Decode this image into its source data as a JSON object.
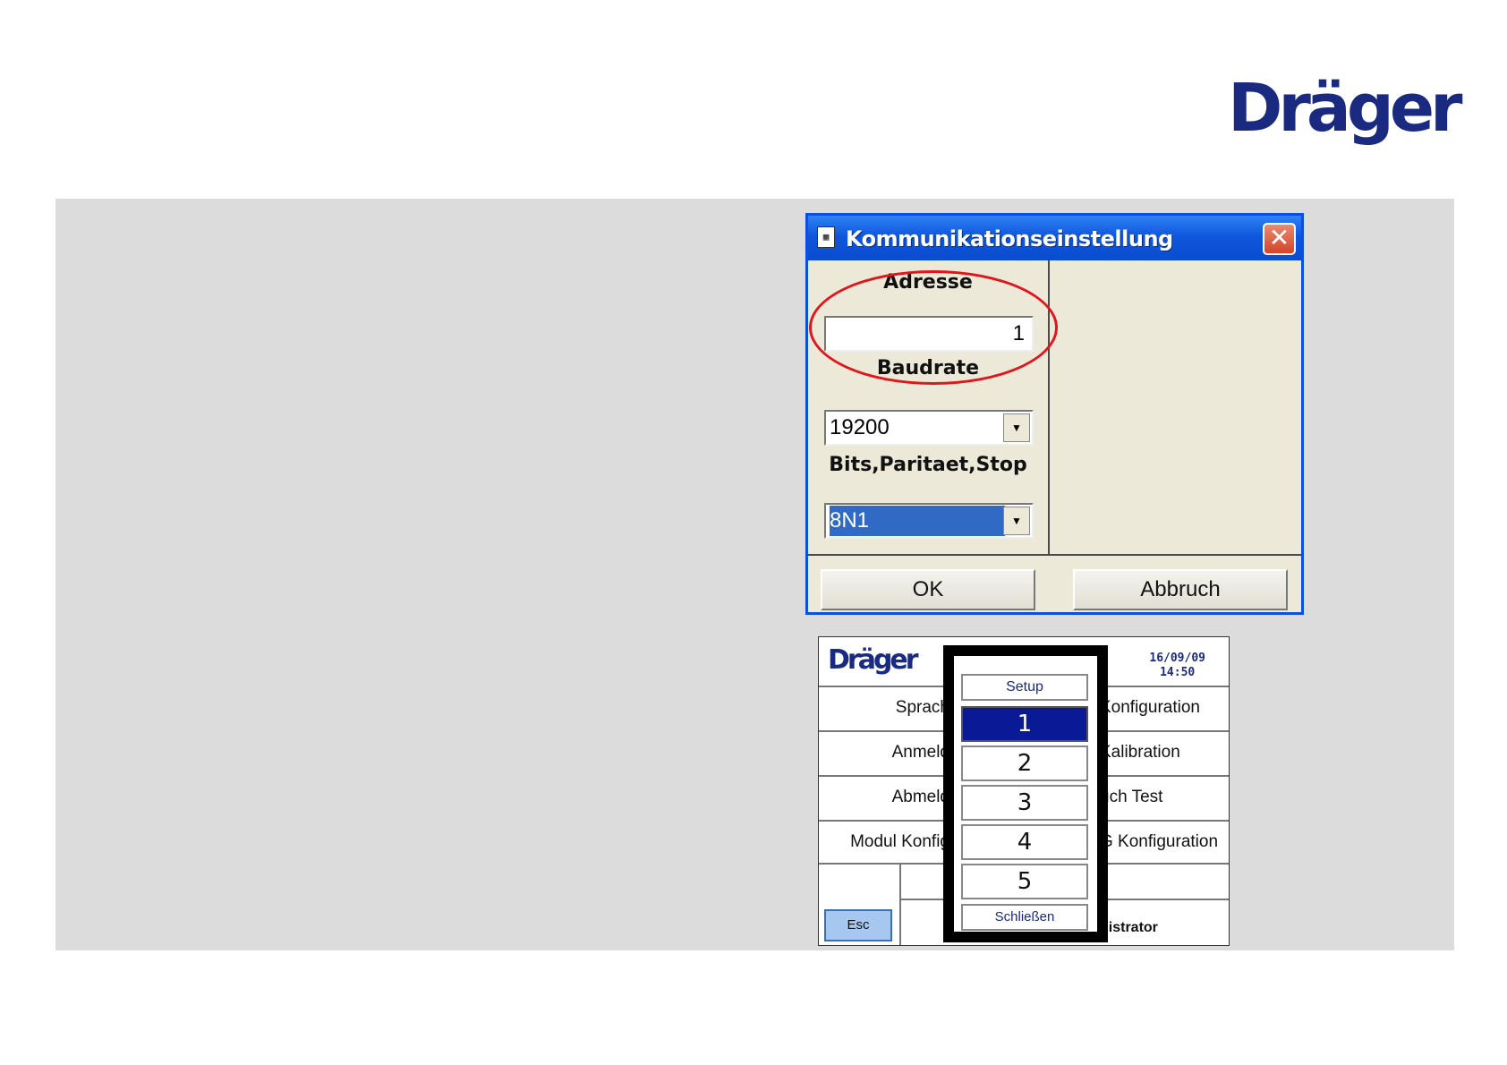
{
  "brand": {
    "logo_text": "Dräger",
    "color": "#1a2a80"
  },
  "dialog": {
    "title": "Kommunikationseinstellung",
    "title_icon": "app-window-icon",
    "close_icon": "close-icon",
    "address": {
      "label": "Adresse",
      "value": "1"
    },
    "baudrate": {
      "label": "Baudrate",
      "value": "19200"
    },
    "bits": {
      "label": "Bits,Paritaet,Stop",
      "value": "8N1"
    },
    "ok_label": "OK",
    "cancel_label": "Abbruch",
    "highlight_color": "#e0161c"
  },
  "device_screen": {
    "logo_text": "Dräger",
    "date": "16/09/09",
    "time": "14:50",
    "rows": [
      {
        "left": "Sprach",
        "right": "Konfiguration"
      },
      {
        "left": "Anmeld",
        "right": "Kalibration"
      },
      {
        "left": "Abmeld",
        "right": "uch Test"
      },
      {
        "left": "Modul Konfig",
        "right": "G Konfiguration"
      }
    ],
    "esc_label": "Esc",
    "user_label": "nistrator",
    "popup": {
      "title": "Setup",
      "items": [
        "1",
        "2",
        "3",
        "4",
        "5"
      ],
      "selected": "1",
      "close_label": "Schließen"
    }
  }
}
